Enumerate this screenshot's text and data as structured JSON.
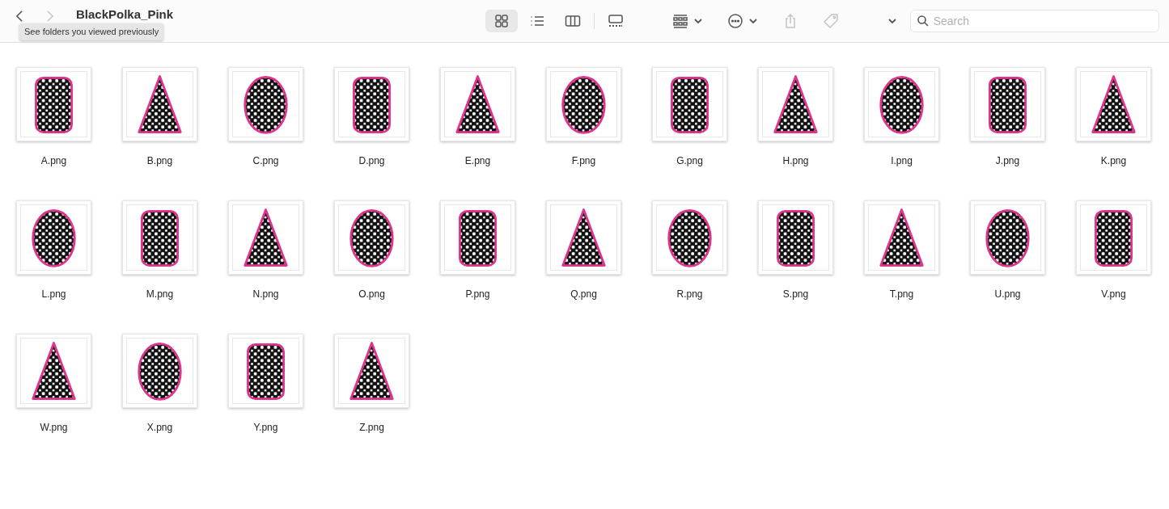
{
  "window": {
    "title": "BlackPolka_Pink"
  },
  "tooltip": "See folders you viewed previously",
  "navigation": [
    {
      "kind": "back",
      "disabled": false
    },
    {
      "kind": "forward",
      "disabled": true
    }
  ],
  "view_modes": [
    {
      "kind": "icons",
      "selected": true
    },
    {
      "kind": "list",
      "selected": false
    },
    {
      "kind": "columns",
      "selected": false
    },
    {
      "kind": "gallery",
      "selected": false
    }
  ],
  "actions": [
    {
      "kind": "group",
      "disabled": false
    },
    {
      "kind": "more",
      "disabled": false
    },
    {
      "kind": "share",
      "disabled": true
    },
    {
      "kind": "tag",
      "disabled": true
    },
    {
      "kind": "overflow",
      "disabled": false
    }
  ],
  "search": {
    "placeholder": "Search"
  },
  "files": [
    {
      "name": "A.png"
    },
    {
      "name": "B.png"
    },
    {
      "name": "C.png"
    },
    {
      "name": "D.png"
    },
    {
      "name": "E.png"
    },
    {
      "name": "F.png"
    },
    {
      "name": "G.png"
    },
    {
      "name": "H.png"
    },
    {
      "name": "I.png"
    },
    {
      "name": "J.png"
    },
    {
      "name": "K.png"
    },
    {
      "name": "L.png"
    },
    {
      "name": "M.png"
    },
    {
      "name": "N.png"
    },
    {
      "name": "O.png"
    },
    {
      "name": "P.png"
    },
    {
      "name": "Q.png"
    },
    {
      "name": "R.png"
    },
    {
      "name": "S.png"
    },
    {
      "name": "T.png"
    },
    {
      "name": "U.png"
    },
    {
      "name": "V.png"
    },
    {
      "name": "W.png"
    },
    {
      "name": "X.png"
    },
    {
      "name": "Y.png"
    },
    {
      "name": "Z.png"
    }
  ]
}
